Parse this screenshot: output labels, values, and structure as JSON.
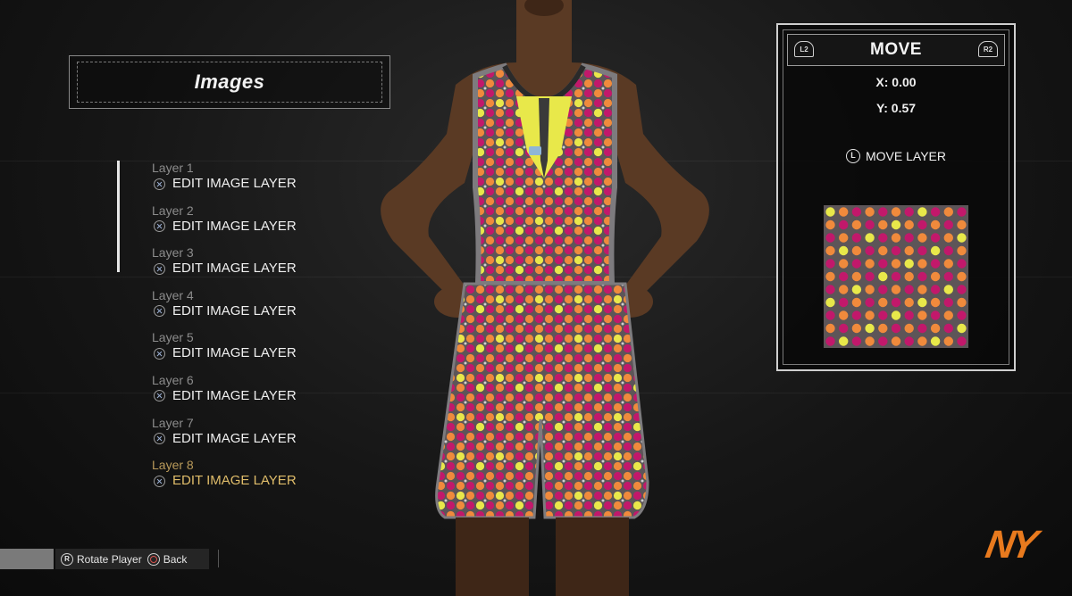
{
  "header": {
    "title": "Images"
  },
  "layers": [
    {
      "name": "Layer 1",
      "action": "EDIT IMAGE LAYER"
    },
    {
      "name": "Layer 2",
      "action": "EDIT IMAGE LAYER"
    },
    {
      "name": "Layer 3",
      "action": "EDIT IMAGE LAYER"
    },
    {
      "name": "Layer 4",
      "action": "EDIT IMAGE LAYER"
    },
    {
      "name": "Layer 5",
      "action": "EDIT IMAGE LAYER"
    },
    {
      "name": "Layer 6",
      "action": "EDIT IMAGE LAYER"
    },
    {
      "name": "Layer 7",
      "action": "EDIT IMAGE LAYER"
    },
    {
      "name": "Layer 8",
      "action": "EDIT IMAGE LAYER"
    }
  ],
  "selected_layer_index": 7,
  "move_panel": {
    "title": "MOVE",
    "l2_label": "L2",
    "r2_label": "R2",
    "x_label": "X: 0.00",
    "y_label": "Y: 0.57",
    "stick_label": "L",
    "move_layer_label": "MOVE LAYER"
  },
  "hints": {
    "rotate_button": "R",
    "rotate_label": "Rotate Player",
    "back_label": "Back"
  },
  "logo_text": "NY",
  "colors": {
    "pattern_bg": "#5d5558",
    "dot_magenta": "#c2186b",
    "dot_orange": "#f08a3c",
    "dot_yellow": "#e8e84a",
    "selected_text": "#e0bd6a",
    "logo_orange": "#e87a1e"
  }
}
